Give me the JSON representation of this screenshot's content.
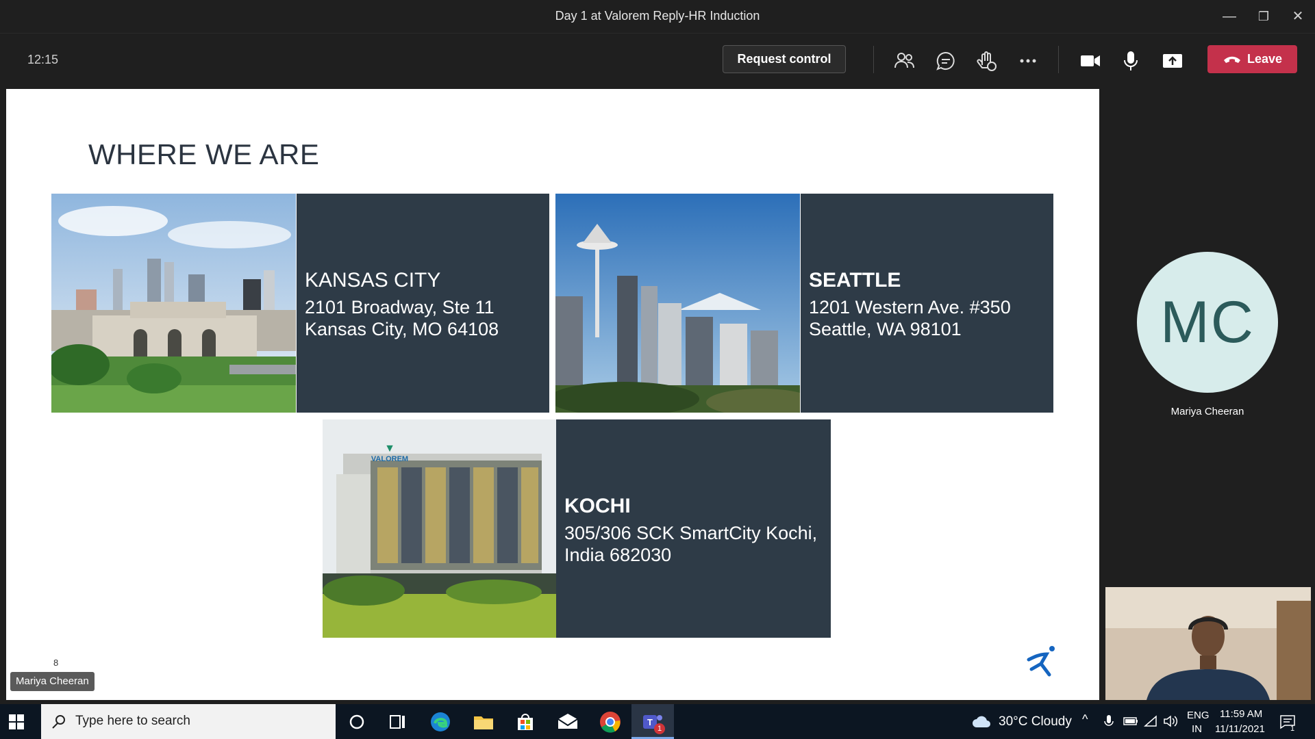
{
  "window": {
    "title": "Day 1 at Valorem Reply-HR Induction",
    "minimize": "—",
    "restore": "❐",
    "close": "✕"
  },
  "toolbar": {
    "clock": "12:15",
    "request_control": "Request control",
    "leave": "Leave"
  },
  "slide": {
    "title": "WHERE WE ARE",
    "page_number": "8",
    "locations": [
      {
        "city": "KANSAS CITY",
        "line1": "2101 Broadway, Ste 11",
        "line2": "Kansas City, MO 64108"
      },
      {
        "city": "SEATTLE",
        "line1": "1201 Western Ave. #350",
        "line2": "Seattle, WA 98101"
      },
      {
        "city": "KOCHI",
        "line1": "305/306 SCK SmartCity Kochi,",
        "line2": "India 682030"
      }
    ],
    "logo_text": "VALOREM"
  },
  "presenter_tag": "Mariya Cheeran",
  "participant": {
    "initials": "MC",
    "name": "Mariya Cheeran"
  },
  "taskbar": {
    "search_placeholder": "Type here to search",
    "weather": "30°C  Cloudy",
    "lang1": "ENG",
    "lang2": "IN",
    "time": "11:59 AM",
    "date": "11/11/2021",
    "teams_badge": "1",
    "notif_badge": "1"
  },
  "colors": {
    "panel": "#2e3b47",
    "leave": "#c4314b",
    "avatar_bg": "#d7eceb",
    "taskbar": "#0c1622"
  }
}
